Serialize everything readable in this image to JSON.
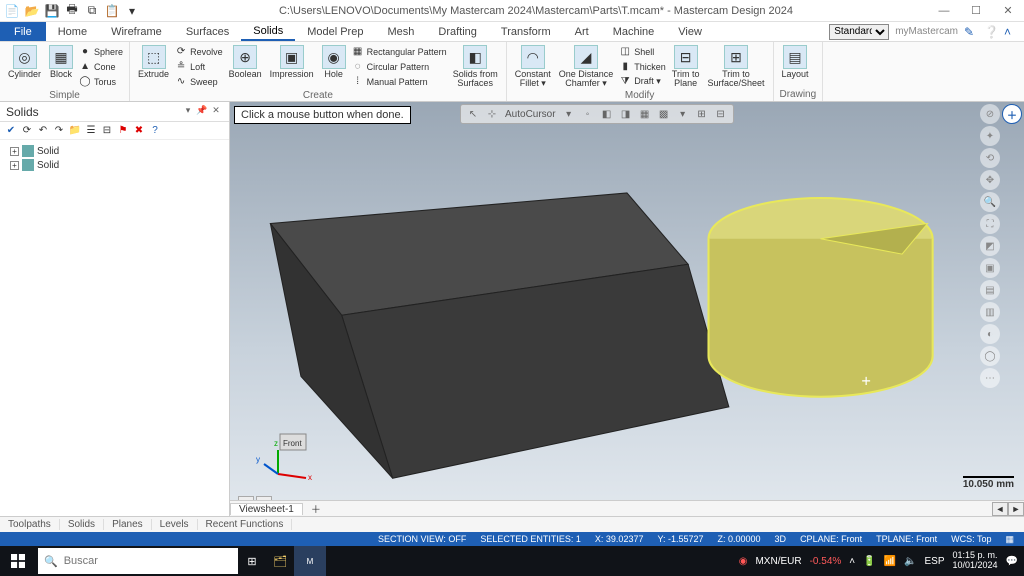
{
  "titlebar": {
    "path": "C:\\Users\\LENOVO\\Documents\\My Mastercam 2024\\Mastercam\\Parts\\T.mcam* - Mastercam Design 2024"
  },
  "qat": [
    "new-icon",
    "open-icon",
    "save-icon",
    "print-icon",
    "undo-icon",
    "redo-icon",
    "dropdown-icon"
  ],
  "menu": {
    "file": "File",
    "tabs": [
      "Home",
      "Wireframe",
      "Surfaces",
      "Solids",
      "Model Prep",
      "Mesh",
      "Drafting",
      "Transform",
      "Art",
      "Machine",
      "View"
    ],
    "active": "Solids",
    "standard": "Standard",
    "brand": "myMastercam"
  },
  "ribbon": {
    "simple": {
      "title": "Simple",
      "cylinder": "Cylinder",
      "block": "Block",
      "items": [
        "Sphere",
        "Cone",
        "Torus"
      ]
    },
    "create": {
      "title": "Create",
      "extrude": "Extrude",
      "col1": [
        "Revolve",
        "Loft",
        "Sweep"
      ],
      "boolean": "Boolean",
      "impression": "Impression",
      "hole": "Hole",
      "patterns": [
        "Rectangular Pattern",
        "Circular Pattern",
        "Manual Pattern"
      ],
      "solidsfrom": "Solids from\nSurfaces"
    },
    "modify": {
      "title": "Modify",
      "fillet": "Constant\nFillet ▾",
      "chamfer": "One Distance\nChamfer ▾",
      "items": [
        "Shell",
        "Thicken",
        "Draft ▾"
      ],
      "trimplane": "Trim to\nPlane",
      "trimsurf": "Trim to\nSurface/Sheet"
    },
    "drawing": {
      "title": "Drawing",
      "layout": "Layout"
    }
  },
  "sidebar": {
    "title": "Solids",
    "tree": [
      "Solid",
      "Solid"
    ]
  },
  "viewport": {
    "prompt": "Click a mouse button when done.",
    "autocursor": "AutoCursor",
    "scale": "10.050 mm",
    "viewsheet": "Viewsheet-1"
  },
  "bottom_tabs": [
    "Toolpaths",
    "Solids",
    "Planes",
    "Levels",
    "Recent Functions"
  ],
  "status": {
    "section": "SECTION VIEW: OFF",
    "selected": "SELECTED ENTITIES: 1",
    "x": "X: 39.02377",
    "y": "Y: -1.55727",
    "z": "Z: 0.00000",
    "mode": "3D",
    "cplane": "CPLANE: Front",
    "tplane": "TPLANE: Front",
    "wcs": "WCS: Top"
  },
  "taskbar": {
    "search_placeholder": "Buscar",
    "fx_pair": "MXN/EUR",
    "fx_change": "-0.54%",
    "lang": "ESP",
    "time": "01:15 p. m.",
    "date": "10/01/2024"
  }
}
